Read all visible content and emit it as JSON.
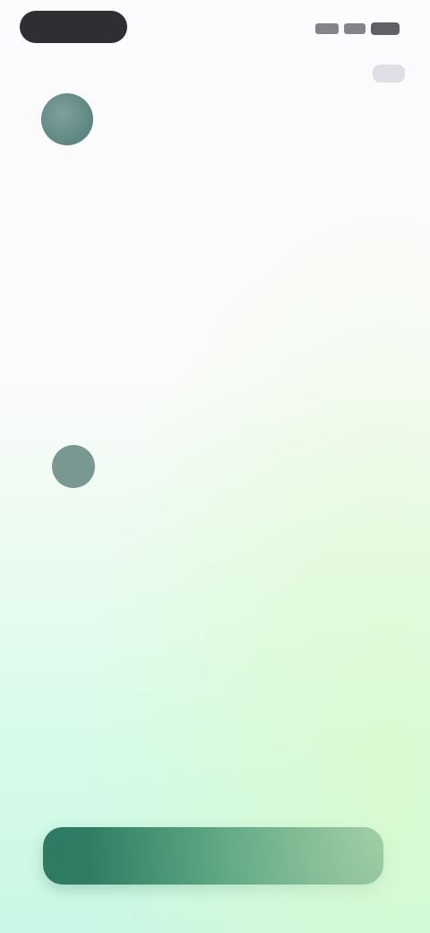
{
  "status_bar": {
    "time": "",
    "icons": [
      "signal-icon",
      "wifi-icon",
      "battery-icon"
    ]
  },
  "header": {
    "action_label": ""
  },
  "main": {
    "logo_icon": "app-logo-icon",
    "title_line_1": "",
    "title_line_2": "",
    "subtitle": ""
  },
  "section": {
    "label": ""
  },
  "user": {
    "name": "",
    "line_1": "",
    "line_2": "",
    "line_3": "",
    "meta": ""
  },
  "primary_button": {
    "label": ""
  },
  "colors": {
    "accent": "#2a8466",
    "avatar": "#7a9892",
    "title_text": "#2a2a30",
    "background_top": "#fdfbfd",
    "background_bottom": "#c9f8e6"
  }
}
